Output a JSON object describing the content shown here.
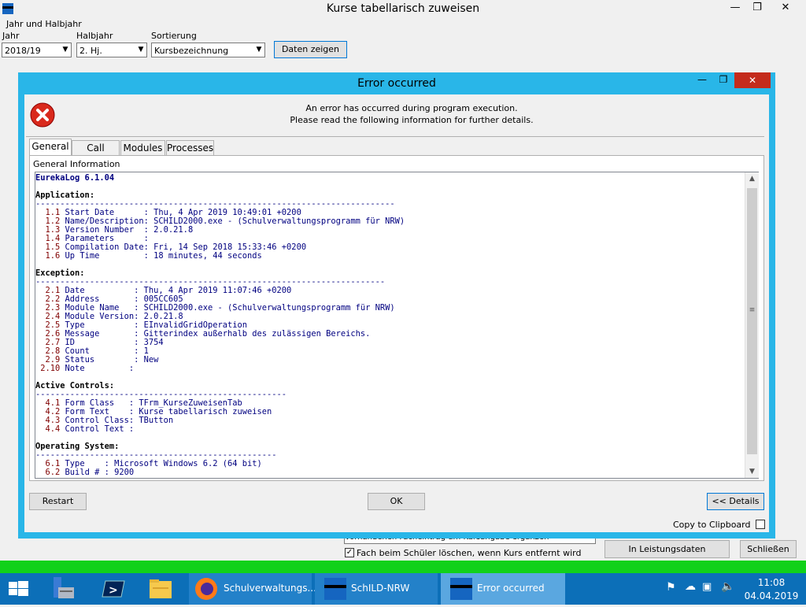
{
  "window": {
    "title": "Kurse tabellarisch zuweisen"
  },
  "filters": {
    "heading": "Jahr und Halbjahr",
    "jahr_label": "Jahr",
    "jahr_value": "2018/19",
    "halbjahr_label": "Halbjahr",
    "halbjahr_value": "2. Hj.",
    "sortierung_label": "Sortierung",
    "sortierung_value": "Kursbezeichnung",
    "show_button": "Daten zeigen"
  },
  "bottom": {
    "partial_field": "Vorhandenen Facheintrag um Kursangabe ergänzen",
    "checkbox_label": "Fach beim Schüler löschen, wenn Kurs entfernt wird",
    "transfer_button": "In Leistungsdaten übernehmen",
    "close_button": "Schließen"
  },
  "dialog": {
    "title": "Error occurred",
    "message_line1": "An error has occurred during program execution.",
    "message_line2": "Please read the following information for further details.",
    "tabs": [
      "General",
      "Call Stack",
      "Modules",
      "Processes"
    ],
    "group_label": "General Information",
    "restart_button": "Restart",
    "ok_button": "OK",
    "details_button": "<< Details",
    "clipboard_label": "Copy to Clipboard"
  },
  "log": {
    "version": "EurekaLog 6.1.04",
    "sections": [
      {
        "title": "Application:",
        "rule": "-------------------------------------------------------------------------",
        "rows": [
          {
            "num": "1.1",
            "key": "Start Date      ",
            "val": "Thu, 4 Apr 2019 10:49:01 +0200"
          },
          {
            "num": "1.2",
            "key": "Name/Description",
            "val": "SCHILD2000.exe - (Schulverwaltungsprogramm für NRW)"
          },
          {
            "num": "1.3",
            "key": "Version Number  ",
            "val": "2.0.21.8"
          },
          {
            "num": "1.4",
            "key": "Parameters      ",
            "val": ""
          },
          {
            "num": "1.5",
            "key": "Compilation Date",
            "val": "Fri, 14 Sep 2018 15:33:46 +0200"
          },
          {
            "num": "1.6",
            "key": "Up Time         ",
            "val": "18 minutes, 44 seconds"
          }
        ]
      },
      {
        "title": "Exception:",
        "rule": "-----------------------------------------------------------------------",
        "rows": [
          {
            "num": "2.1",
            "key": "Date          ",
            "val": "Thu, 4 Apr 2019 11:07:46 +0200"
          },
          {
            "num": "2.2",
            "key": "Address       ",
            "val": "005CC605"
          },
          {
            "num": "2.3",
            "key": "Module Name   ",
            "val": "SCHILD2000.exe - (Schulverwaltungsprogramm für NRW)"
          },
          {
            "num": "2.4",
            "key": "Module Version",
            "val": "2.0.21.8"
          },
          {
            "num": "2.5",
            "key": "Type          ",
            "val": "EInvalidGridOperation"
          },
          {
            "num": "2.6",
            "key": "Message       ",
            "val": "Gitterindex außerhalb des zulässigen Bereichs."
          },
          {
            "num": "2.7",
            "key": "ID            ",
            "val": "3754"
          },
          {
            "num": "2.8",
            "key": "Count         ",
            "val": "1"
          },
          {
            "num": "2.9",
            "key": "Status        ",
            "val": "New"
          },
          {
            "num": "2.10",
            "key": "Note         ",
            "val": ""
          }
        ]
      },
      {
        "title": "Active Controls:",
        "rule": "---------------------------------------------------",
        "rows": [
          {
            "num": "4.1",
            "key": "Form Class   ",
            "val": "TFrm_KurseZuweisenTab"
          },
          {
            "num": "4.2",
            "key": "Form Text    ",
            "val": "Kurse tabellarisch zuweisen"
          },
          {
            "num": "4.3",
            "key": "Control Class",
            "val": "TButton"
          },
          {
            "num": "4.4",
            "key": "Control Text ",
            "val": ""
          }
        ]
      },
      {
        "title": "Operating System:",
        "rule": "-------------------------------------------------",
        "rows": [
          {
            "num": "6.1",
            "key": "Type    ",
            "val": "Microsoft Windows 6.2 (64 bit)"
          },
          {
            "num": "6.2",
            "key": "Build # ",
            "val": "9200"
          }
        ]
      }
    ]
  },
  "taskbar": {
    "items": [
      "Schulverwaltungs...",
      "SchILD-NRW",
      "Error occurred"
    ],
    "time": "11:08",
    "date": "04.04.2019"
  }
}
